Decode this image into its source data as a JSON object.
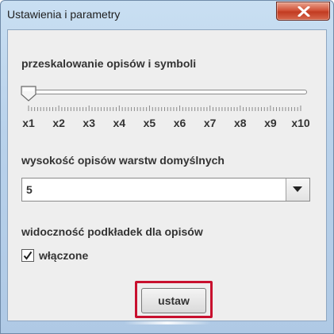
{
  "window": {
    "title": "Ustawienia i parametry",
    "close_icon": "close-x-icon"
  },
  "scale_section": {
    "label": "przeskalowanie opisów i symboli",
    "slider_value_index": 0,
    "tick_labels": [
      "x1",
      "x2",
      "x3",
      "x4",
      "x5",
      "x6",
      "x7",
      "x8",
      "x9",
      "x10"
    ]
  },
  "height_section": {
    "label": "wysokość opisów warstw domyślnych",
    "selected_value": "5",
    "dropdown_icon": "chevron-down-icon"
  },
  "visibility_section": {
    "label": "widoczność podkładek dla opisów",
    "checkbox_label": "włączone",
    "checked": true
  },
  "apply_button": {
    "label": "ustaw",
    "highlight_color": "#c8102e"
  },
  "colors": {
    "frame": "#b9d2eb",
    "client_bg": "#eeeeee",
    "close_button": "#c9442a",
    "text": "#333333"
  }
}
